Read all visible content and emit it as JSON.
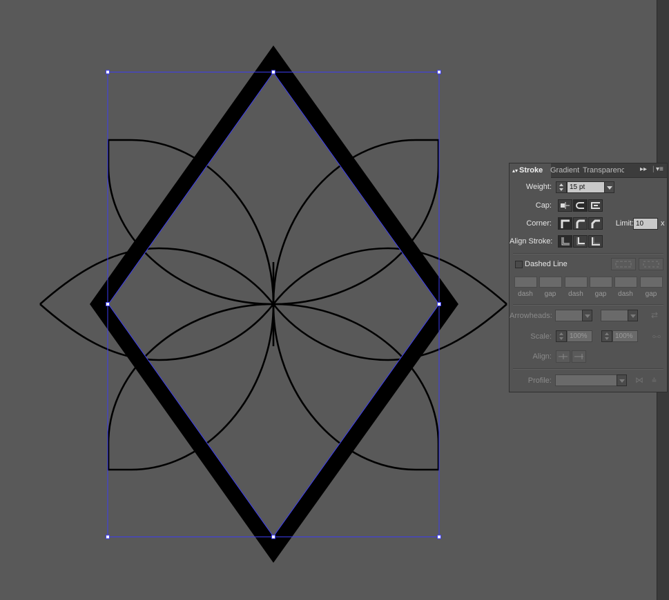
{
  "colors": {
    "canvas": "#595959",
    "selection": "#3d3df0",
    "artwork": "#000000",
    "panel": "#535353"
  },
  "panel": {
    "tabs": {
      "stroke": "Stroke",
      "gradient": "Gradient",
      "transparency": "Transparency"
    },
    "weight": {
      "label": "Weight:",
      "value": "15 pt"
    },
    "cap": {
      "label": "Cap:",
      "icons": [
        "butt-cap-icon",
        "round-cap-icon",
        "projecting-cap-icon"
      ],
      "selected": "round-cap-icon"
    },
    "corner": {
      "label": "Corner:",
      "icons": [
        "miter-join-icon",
        "round-join-icon",
        "bevel-join-icon"
      ],
      "selected": "miter-join-icon"
    },
    "limit": {
      "label": "Limit:",
      "value": "10",
      "unit": "x"
    },
    "align_stroke": {
      "label": "Align Stroke:",
      "icons": [
        "align-center-icon",
        "align-inside-icon",
        "align-outside-icon"
      ],
      "selected": "align-center-icon"
    },
    "dashed_line": {
      "label": "Dashed Line",
      "checked": false
    },
    "dash_labels": [
      "dash",
      "gap",
      "dash",
      "gap",
      "dash",
      "gap"
    ],
    "arrowheads": {
      "label": "Arrowheads:"
    },
    "scale": {
      "label": "Scale:",
      "start": "100%",
      "end": "100%"
    },
    "align": {
      "label": "Align:"
    },
    "profile": {
      "label": "Profile:"
    }
  }
}
